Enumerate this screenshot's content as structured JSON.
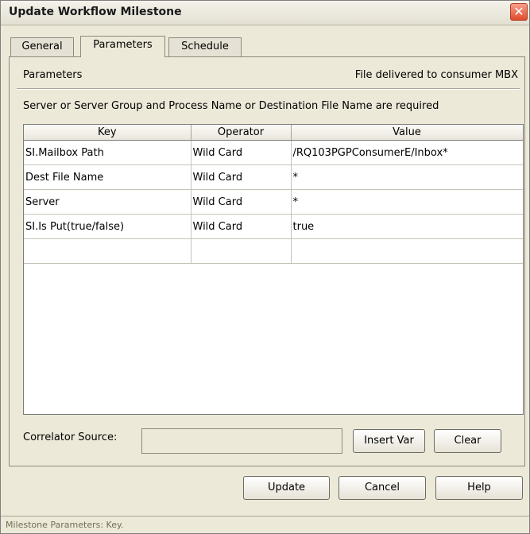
{
  "window": {
    "title": "Update Workflow Milestone",
    "close_glyph": "✕"
  },
  "tabs": [
    {
      "label": "General",
      "active": false
    },
    {
      "label": "Parameters",
      "active": true
    },
    {
      "label": "Schedule",
      "active": false
    }
  ],
  "panel": {
    "heading": "Parameters",
    "file_note": "File delivered to consumer MBX",
    "requirement": "Server or Server Group and Process Name or Destination File Name are required"
  },
  "table": {
    "columns": [
      "Key",
      "Operator",
      "Value"
    ],
    "rows": [
      [
        "SI.Mailbox Path",
        "Wild Card",
        "/RQ103PGPConsumerE/Inbox*"
      ],
      [
        "Dest File Name",
        "Wild Card",
        "*"
      ],
      [
        "Server",
        "Wild Card",
        "*"
      ],
      [
        "SI.Is Put(true/false)",
        "Wild Card",
        "true"
      ],
      [
        "",
        "",
        ""
      ]
    ]
  },
  "correlator": {
    "label": "Correlator Source:",
    "value": ""
  },
  "buttons": {
    "insert_var": "Insert Var",
    "clear": "Clear",
    "update": "Update",
    "cancel": "Cancel",
    "help": "Help"
  },
  "status": "Milestone Parameters: Key."
}
